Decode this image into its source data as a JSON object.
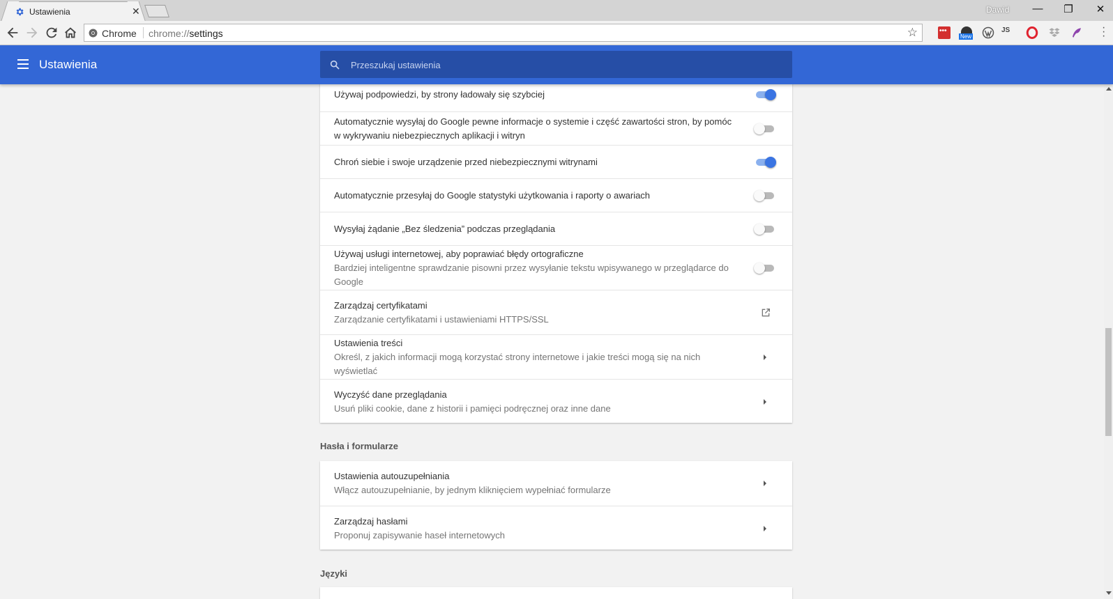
{
  "browser": {
    "tab_title": "Ustawienia",
    "tab_close": "✕",
    "profile_name": "Dawid",
    "window_controls": {
      "minimize": "—",
      "restore": "❐",
      "close": "✕"
    },
    "omnibox": {
      "origin_label": "Chrome",
      "url_scheme": "chrome://",
      "url_path": "settings"
    },
    "extensions": [
      "lastpass-icon",
      "new-badge-extension-icon",
      "wordpress-icon",
      "js-extension-icon",
      "opera-icon",
      "dropbox-icon",
      "feather-icon"
    ],
    "new_badge": "New",
    "js_label": "JS",
    "lastpass_label": "•••",
    "accent_color": "#3367d6"
  },
  "settings_header": {
    "title": "Ustawienia",
    "search_placeholder": "Przeszukaj ustawienia"
  },
  "privacy_rows": [
    {
      "title": "Używaj podpowiedzi, by strony ładowały się szybciej",
      "subtitle": "",
      "control": "toggle",
      "state": "on"
    },
    {
      "title": "Automatycznie wysyłaj do Google pewne informacje o systemie i część zawartości stron, by pomóc",
      "title2": "w wykrywaniu niebezpiecznych aplikacji i witryn",
      "control": "toggle",
      "state": "off"
    },
    {
      "title": "Chroń siebie i swoje urządzenie przed niebezpiecznymi witrynami",
      "subtitle": "",
      "control": "toggle",
      "state": "on"
    },
    {
      "title": "Automatycznie przesyłaj do Google statystyki użytkowania i raporty o awariach",
      "subtitle": "",
      "control": "toggle",
      "state": "off"
    },
    {
      "title": "Wysyłaj żądanie „Bez śledzenia” podczas przeglądania",
      "subtitle": "",
      "control": "toggle",
      "state": "off"
    },
    {
      "title": "Używaj usługi internetowej, aby poprawiać błędy ortograficzne",
      "subtitle": "Bardziej inteligentne sprawdzanie pisowni przez wysyłanie tekstu wpisywanego w przeglądarce do",
      "subtitle2": "Google",
      "control": "toggle",
      "state": "off"
    },
    {
      "title": "Zarządzaj certyfikatami",
      "subtitle": "Zarządzanie certyfikatami i ustawieniami HTTPS/SSL",
      "control": "external-link"
    },
    {
      "title": "Ustawienia treści",
      "subtitle": "Określ, z jakich informacji mogą korzystać strony internetowe i jakie treści mogą się na nich",
      "subtitle2": "wyświetlać",
      "control": "arrow"
    },
    {
      "title": "Wyczyść dane przeglądania",
      "subtitle": "Usuń pliki cookie, dane z historii i pamięci podręcznej oraz inne dane",
      "control": "arrow"
    }
  ],
  "passwords_section": {
    "title": "Hasła i formularze",
    "rows": [
      {
        "title": "Ustawienia autouzupełniania",
        "subtitle": "Włącz autouzupełnianie, by jednym kliknięciem wypełniać formularze",
        "control": "arrow"
      },
      {
        "title": "Zarządzaj hasłami",
        "subtitle": "Proponuj zapisywanie haseł internetowych",
        "control": "arrow"
      }
    ]
  },
  "languages_section": {
    "title": "Języki"
  }
}
